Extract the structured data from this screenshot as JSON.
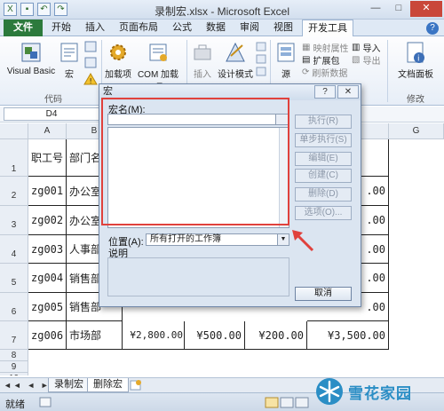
{
  "window": {
    "title": "录制宏.xlsx - Microsoft Excel",
    "controls": [
      "—",
      "□",
      "✕"
    ]
  },
  "ribbon": {
    "tabs": [
      "文件",
      "开始",
      "插入",
      "页面布局",
      "公式",
      "数据",
      "审阅",
      "视图",
      "开发工具"
    ],
    "active_tab": "开发工具",
    "code_group": {
      "label": "代码",
      "visual_basic": "Visual Basic",
      "macros": "宏"
    },
    "addins": {
      "addins_label": "加载项",
      "com_label": "COM 加载项"
    },
    "controls": {
      "insert_label": "插入",
      "design_mode_label": "设计模式"
    },
    "xml": {
      "source_label": "源",
      "map_properties": "映射属性",
      "expansion_packs": "扩展包",
      "refresh_data": "刷新数据",
      "import": "导入",
      "export": "导出"
    },
    "modify": {
      "label": "修改",
      "document_panel": "文档面板"
    }
  },
  "formula_bar": {
    "name_box": "D4"
  },
  "sheet": {
    "columns": [
      "A",
      "B",
      "C",
      "D",
      "E",
      "F",
      "G"
    ],
    "rows": [
      "1",
      "2",
      "3",
      "4",
      "5",
      "6",
      "7",
      "8",
      "9",
      "10"
    ],
    "cells": {
      "a1": "职工号",
      "b1": "部门名",
      "a2": "zg001",
      "b2": "办公室",
      "a3": "zg002",
      "b3": "办公室",
      "a4": "zg003",
      "b4": "人事部",
      "a5": "zg004",
      "b5": "销售部",
      "a6": "zg005",
      "b6": "销售部",
      "a7": "zg006",
      "b7": "市场部",
      "c7": "¥2,800.00",
      "d7": "¥500.00",
      "e7": "¥200.00",
      "f7": "¥3,500.00",
      "f2": ".00",
      "f3": ".00",
      "f4": ".00",
      "f5": ".00",
      "f6": ".00"
    },
    "tabs": [
      "录制宏",
      "删除宏"
    ],
    "active_tab": "删除宏",
    "nav": "◄◄ ◄ ► ►►"
  },
  "status": {
    "ready": "就绪"
  },
  "dialog": {
    "title": "宏",
    "help": "?",
    "close": "✕",
    "macro_name_label": "宏名(M):",
    "macro_name_value": "",
    "buttons": {
      "run": "执行(R)",
      "step_into": "单步执行(S)",
      "edit": "编辑(E)",
      "create": "创建(C)",
      "delete": "删除(D)",
      "options": "选项(O)...",
      "cancel": "取消"
    },
    "location_label": "位置(A):",
    "location_value": "所有打开的工作簿",
    "description_label": "说明"
  },
  "watermark": {
    "text": "雪花家园"
  },
  "colors": {
    "file_tab": "#2c7a3c",
    "highlight": "#e0413c",
    "dialog_bg": "#dbe5f1",
    "watermark": "#2b8ec5"
  }
}
